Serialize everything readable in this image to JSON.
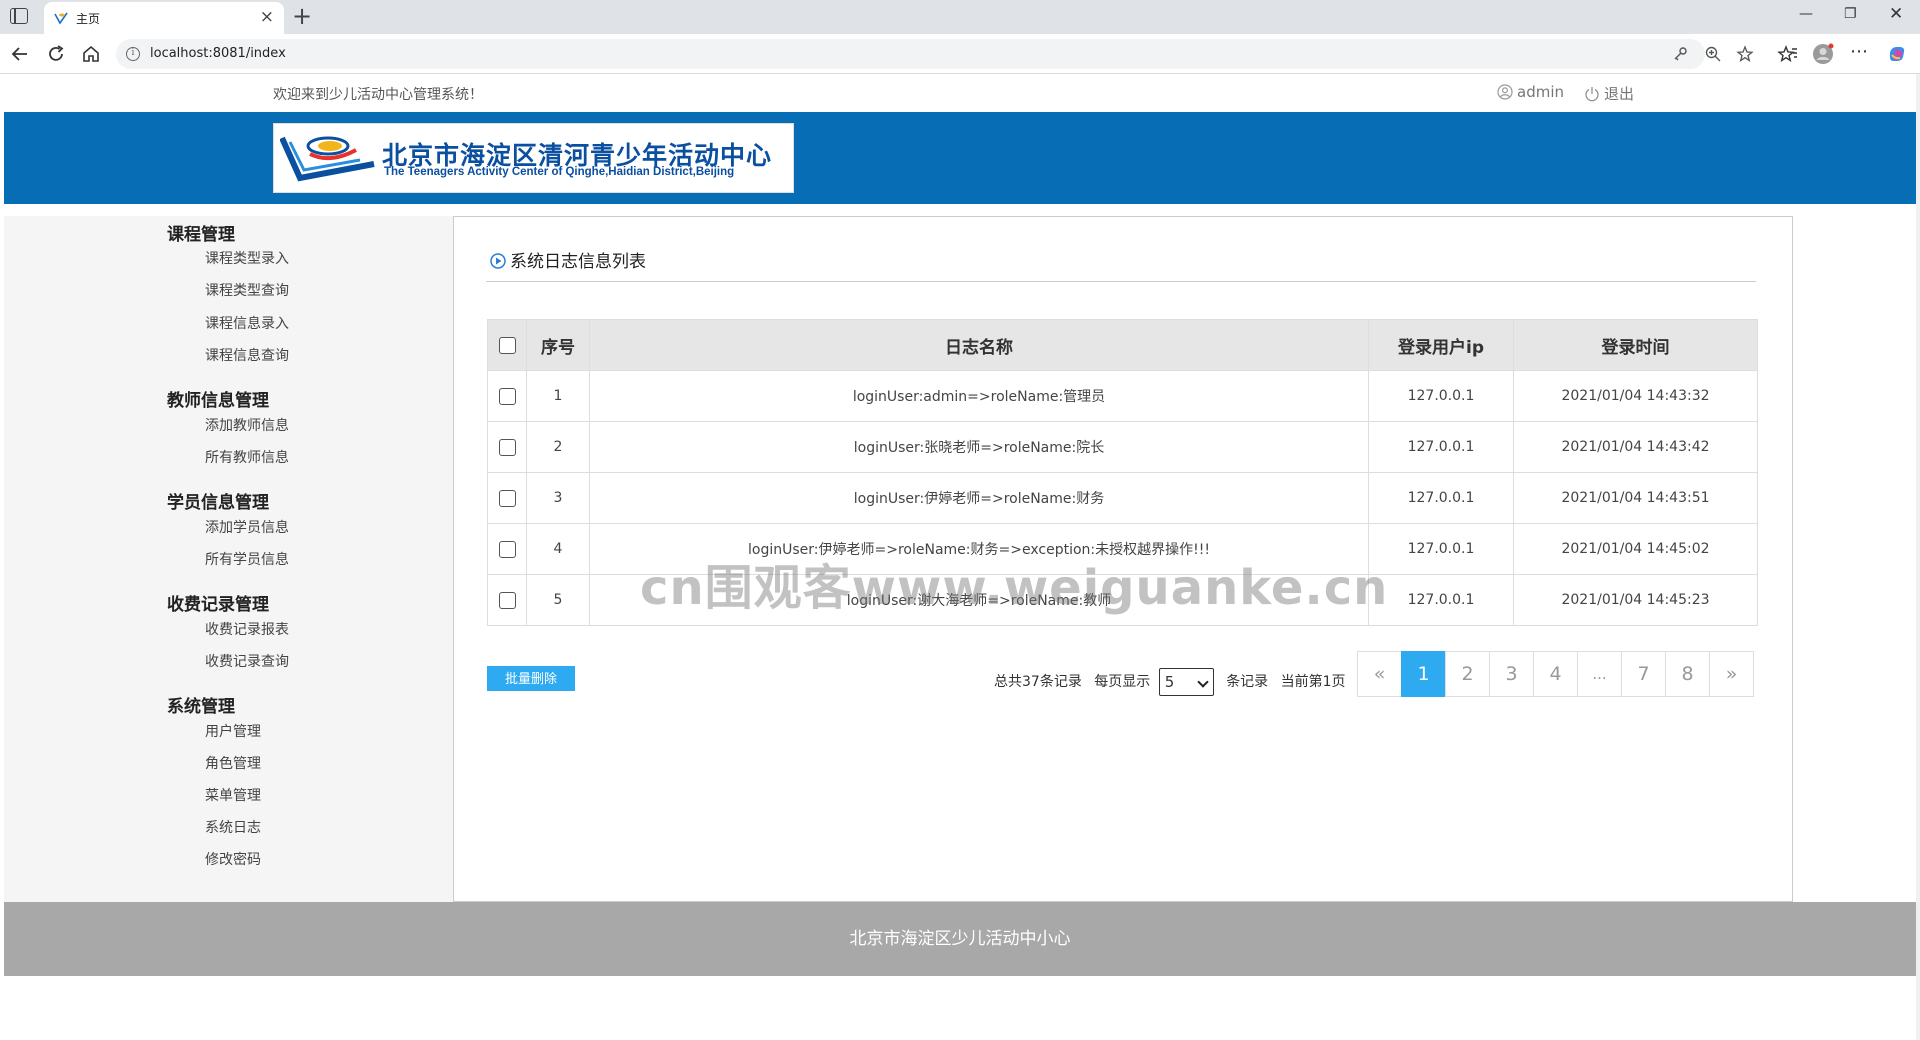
{
  "browser": {
    "tab_title": "主页",
    "url": "localhost:8081/index"
  },
  "topbar": {
    "welcome": "欢迎来到少儿活动中心管理系统！",
    "user": "admin",
    "logout": "退出"
  },
  "logo": {
    "cn": "北京市海淀区清河青少年活动中心",
    "en": "The Teenagers Activity Center of Qinghe,Haidian District,Beijing"
  },
  "sidebar": {
    "groups": [
      {
        "title": "课程管理",
        "items": [
          "课程类型录入",
          "课程类型查询",
          "课程信息录入",
          "课程信息查询"
        ]
      },
      {
        "title": "教师信息管理",
        "items": [
          "添加教师信息",
          "所有教师信息"
        ]
      },
      {
        "title": "学员信息管理",
        "items": [
          "添加学员信息",
          "所有学员信息"
        ]
      },
      {
        "title": "收费记录管理",
        "items": [
          "收费记录报表",
          "收费记录查询"
        ]
      },
      {
        "title": "系统管理",
        "items": [
          "用户管理",
          "角色管理",
          "菜单管理",
          "系统日志",
          "修改密码"
        ]
      }
    ]
  },
  "main": {
    "title": "系统日志信息列表",
    "columns": [
      "序号",
      "日志名称",
      "登录用户ip",
      "登录时间"
    ],
    "rows": [
      {
        "no": "1",
        "name": "loginUser:admin=>roleName:管理员",
        "ip": "127.0.0.1",
        "time": "2021/01/04 14:43:32"
      },
      {
        "no": "2",
        "name": "loginUser:张晓老师=>roleName:院长",
        "ip": "127.0.0.1",
        "time": "2021/01/04 14:43:42"
      },
      {
        "no": "3",
        "name": "loginUser:伊婷老师=>roleName:财务",
        "ip": "127.0.0.1",
        "time": "2021/01/04 14:43:51"
      },
      {
        "no": "4",
        "name": "loginUser:伊婷老师=>roleName:财务=>exception:未授权越界操作!!!",
        "ip": "127.0.0.1",
        "time": "2021/01/04 14:45:02"
      },
      {
        "no": "5",
        "name": "loginUser:谢大海老师=>roleName:教师",
        "ip": "127.0.0.1",
        "time": "2021/01/04 14:45:23"
      }
    ],
    "batch_delete": "批量删除",
    "pager": {
      "total": "总共37条记录",
      "per_page_label": "每页显示",
      "page_size": "5",
      "records_label": "条记录",
      "current": "当前第1页",
      "pages": [
        "«",
        "1",
        "2",
        "3",
        "4",
        "...",
        "7",
        "8",
        "»"
      ]
    }
  },
  "footer": {
    "text": "北京市海淀区少儿活动中小心"
  },
  "watermark": "cn围观客www.weiguanke.cn",
  "colors": {
    "banner": "#076db5",
    "accent": "#2eaaf0",
    "footer": "#a8a8a8"
  }
}
